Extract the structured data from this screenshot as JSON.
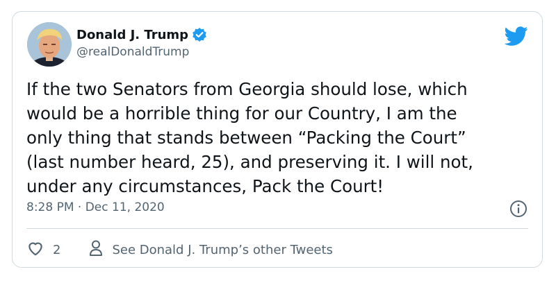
{
  "tweet": {
    "author_name": "Donald J. Trump",
    "author_handle": "@realDonaldTrump",
    "text": "If the two Senators from Georgia should lose, which\nwould be a horrible thing for our Country, I am the\nonly thing that stands between “Packing the Court”\n(last number heard, 25), and preserving it. I will not,\nunder any circumstances, Pack the Court!",
    "timestamp": "8:28 PM · Dec 11, 2020",
    "like_count": "2",
    "see_tweets_label": "See Donald J. Trump’s other Tweets"
  },
  "icons": {
    "verified": "verified-badge-icon",
    "brand": "twitter-bird-icon",
    "info": "info-icon",
    "like": "heart-icon",
    "profile": "person-icon"
  },
  "colors": {
    "brand": "#1d9bf0",
    "text": "#0f1419",
    "secondary": "#536471",
    "border": "#cfd9de"
  }
}
